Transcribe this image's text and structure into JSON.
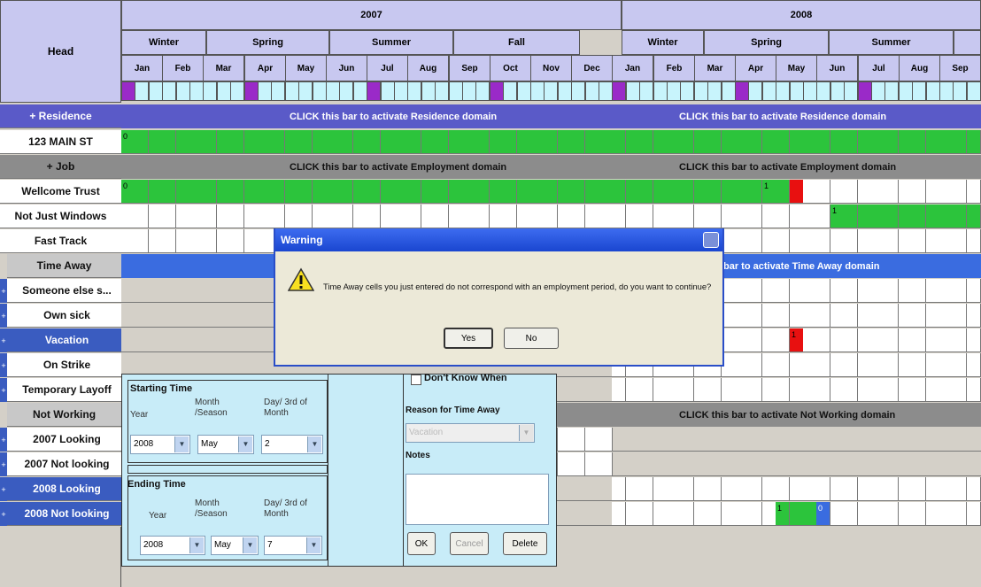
{
  "head": "Head",
  "years": [
    "2007",
    "2008"
  ],
  "seasons": [
    "Winter",
    "Spring",
    "Summer",
    "Fall",
    "Winter",
    "Spring",
    "Summer"
  ],
  "months": [
    "Jan",
    "Feb",
    "Mar",
    "Apr",
    "May",
    "Jun",
    "Jul",
    "Aug",
    "Sep",
    "Oct",
    "Nov",
    "Dec",
    "Jan",
    "Feb",
    "Mar",
    "Apr",
    "May",
    "Jun",
    "Jul",
    "Aug",
    "Sep"
  ],
  "labels": {
    "residence": "+ Residence",
    "main_st": "123 MAIN ST",
    "job": "+ Job",
    "wellcome": "Wellcome Trust",
    "not_just_windows": "Not Just Windows",
    "fast_track": "Fast Track",
    "time_away": "Time Away",
    "someone_else": "Someone else s...",
    "own_sick": "Own sick",
    "vacation": "Vacation",
    "on_strike": "On Strike",
    "temp_layoff": "Temporary Layoff",
    "not_working": "Not Working",
    "looking_2007": "2007 Looking",
    "not_looking_2007": "2007 Not looking",
    "looking_2008": "2008 Looking",
    "not_looking_2008": "2008 Not looking",
    "side_plus": "+"
  },
  "bars": {
    "residence": "CLICK this bar to activate Residence domain",
    "job": "CLICK this bar to activate Employment domain",
    "time_away": "bar to activate Time Away domain",
    "not_working": "CLICK this bar to activate Not Working domain"
  },
  "cell_marks": {
    "green_start": "0",
    "one": "1"
  },
  "dialog": {
    "title": "Warning",
    "message": "Time Away cells you just entered do not correspond with an employment period, do you want to continue?",
    "yes": "Yes",
    "no": "No",
    "icon": "warning-icon"
  },
  "editor": {
    "starting_time": "Starting Time",
    "ending_time": "Ending Time",
    "year_label": "Year",
    "month_label": "Month /Season",
    "day_label": "Day/ 3rd of Month",
    "start_year": "2008",
    "start_month": "May",
    "start_day": "2",
    "end_year": "2008",
    "end_month": "May",
    "end_day": "7",
    "dont_know": "Don't Know When",
    "reason_label": "Reason for Time Away",
    "reason_value": "Vacation",
    "notes_label": "Notes",
    "ok": "OK",
    "cancel": "Cancel",
    "delete": "Delete"
  },
  "colors": {
    "header": "#c8c8f0",
    "green": "#2cc43c",
    "red": "#e81010",
    "blue_bar": "#5a5ac8"
  }
}
